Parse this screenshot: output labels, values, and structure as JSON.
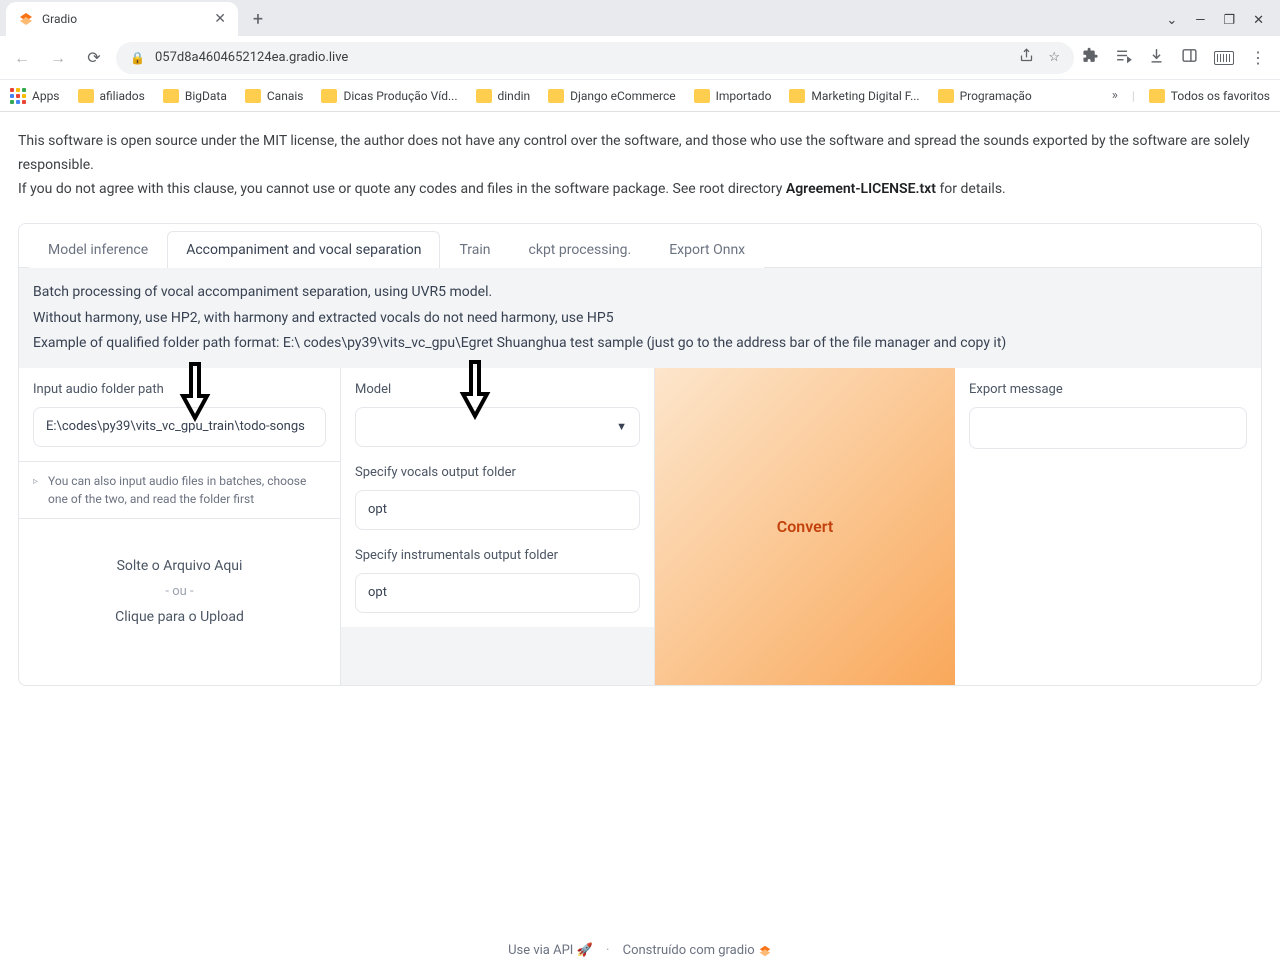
{
  "browser": {
    "tab_title": "Gradio",
    "url": "057d8a4604652124ea.gradio.live",
    "bookmarks": {
      "apps": "Apps",
      "items": [
        "afiliados",
        "BigData",
        "Canais",
        "Dicas Produção Víd...",
        "dindin",
        "Django eCommerce",
        "Importado",
        "Marketing Digital F...",
        "Programação"
      ],
      "all": "Todos os favoritos"
    }
  },
  "disclaimer": {
    "line1": "This software is open source under the MIT license, the author does not have any control over the software, and those who use the software and spread the sounds exported by the software are solely responsible.",
    "line2_a": "If you do not agree with this clause, you cannot use or quote any codes and files in the software package. See root directory ",
    "line2_b": "Agreement-LICENSE.txt",
    "line2_c": " for details."
  },
  "tabs": {
    "t1": "Model inference",
    "t2": "Accompaniment and vocal separation",
    "t3": "Train",
    "t4": "ckpt processing.",
    "t5": "Export Onnx"
  },
  "banner": {
    "l1": "Batch processing of vocal accompaniment separation, using UVR5 model.",
    "l2": "Without harmony, use HP2, with harmony and extracted vocals do not need harmony, use HP5",
    "l3": "Example of qualified folder path format: E:\\ codes\\py39\\vits_vc_gpu\\Egret Shuanghua test sample (just go to the address bar of the file manager and copy it)"
  },
  "col1": {
    "label": "Input audio folder path",
    "value": "E:\\codes\\py39\\vits_vc_gpu_train\\todo-songs",
    "help": "You can also input audio files in batches, choose one of the two, and read the folder first",
    "drop1": "Solte o Arquivo Aqui",
    "drop_or": "- ou -",
    "drop2": "Clique para o Upload"
  },
  "col2": {
    "model_label": "Model",
    "vocals_label": "Specify vocals output folder",
    "vocals_value": "opt",
    "instr_label": "Specify instrumentals output folder",
    "instr_value": "opt"
  },
  "col3": {
    "convert": "Convert"
  },
  "col4": {
    "label": "Export message"
  },
  "footer": {
    "api": "Use via API",
    "built": "Construído com gradio"
  }
}
